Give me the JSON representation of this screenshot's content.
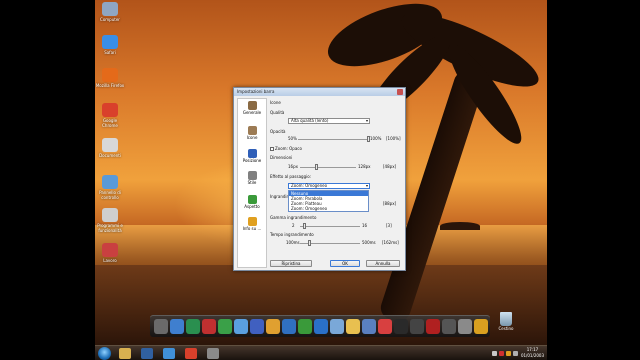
{
  "window": {
    "title": "Impostazioni barra"
  },
  "desktop_icons": [
    {
      "label": "Computer",
      "icon": "computer-icon",
      "color": "#8fa6c2"
    },
    {
      "label": "Safari",
      "icon": "safari-icon",
      "color": "#3a8ee6"
    },
    {
      "label": "Mozilla Firefox",
      "icon": "firefox-icon",
      "color": "#e46a1a"
    },
    {
      "label": "Google Chrome",
      "icon": "chrome-icon",
      "color": "#d9402b"
    },
    {
      "label": "Documenti",
      "icon": "documents-icon",
      "color": "#d8d8d8"
    },
    {
      "label": "Pannello di controllo",
      "icon": "control-panel-icon",
      "color": "#5a9ad8"
    },
    {
      "label": "Programmi e funzionalità",
      "icon": "programs-icon",
      "color": "#cfcfcf"
    },
    {
      "label": "Lavoro",
      "icon": "work-icon",
      "color": "#c94040"
    }
  ],
  "sidebar": {
    "items": [
      {
        "label": "Generale",
        "icon": "tools-icon",
        "color": "#8a6a44"
      },
      {
        "label": "Icone",
        "icon": "icons-icon",
        "color": "#9c7b54"
      },
      {
        "label": "Posizione",
        "icon": "position-icon",
        "color": "#2f5fb8"
      },
      {
        "label": "Stile",
        "icon": "brush-icon",
        "color": "#808080"
      },
      {
        "label": "Aspetto",
        "icon": "appearance-icon",
        "color": "#3a9a3a"
      },
      {
        "label": "Info su ...",
        "icon": "info-icon",
        "color": "#e0a020"
      }
    ]
  },
  "settings": {
    "section": "Icone",
    "quality_label": "Qualità",
    "quality_value": "Alta qualità (lento)",
    "opacity_label": "Opacità",
    "opacity_min": "50%",
    "opacity_max": "100%",
    "opacity_value": "[100%]",
    "opacity_level": 1.0,
    "zoom_opaque_label": "Zoom: Opaco",
    "dimensions_label": "Dimensioni",
    "dim_min": "16px",
    "dim_max": "128px",
    "dim_value": "[48px]",
    "dim_level": 0.29,
    "hover_label": "Effetto al passaggio:",
    "hover_value": "Zoom: Omogeneo",
    "hover_options": [
      "Nessuno",
      "Zoom: Parabola",
      "Zoom: Piatteau",
      "Zoom: Omogeneo"
    ],
    "hover_highlighted": "Nessuno",
    "zoom_label": "Ingrandimento",
    "zoom_value": "[88px]",
    "gamma_label": "Gamma ingrandimento",
    "gamma_min": "2",
    "gamma_max": "16",
    "gamma_value": "[3]",
    "gamma_level": 0.07,
    "time_label": "Tempo ingrandimento",
    "time_min": "100ms",
    "time_max": "500ms",
    "time_value": "[162ms]",
    "time_level": 0.16
  },
  "buttons": {
    "reset": "Ripristina",
    "ok": "OK",
    "cancel": "Annulla"
  },
  "dock_icons": [
    {
      "icon": "dock-app-1-icon",
      "color": "#6a6a6a"
    },
    {
      "icon": "dock-app-2-icon",
      "color": "#3f7fcf"
    },
    {
      "icon": "dock-app-3-icon",
      "color": "#2a8f4f"
    },
    {
      "icon": "dock-app-4-icon",
      "color": "#c03030"
    },
    {
      "icon": "dock-chrome-icon",
      "color": "#3aa048"
    },
    {
      "icon": "dock-app-6-icon",
      "color": "#5aa0e0"
    },
    {
      "icon": "dock-app-7-icon",
      "color": "#4060c0"
    },
    {
      "icon": "dock-app-8-icon",
      "color": "#e0a030"
    },
    {
      "icon": "dock-app-9-icon",
      "color": "#3070c0"
    },
    {
      "icon": "dock-utorrent-icon",
      "color": "#3a9a3a"
    },
    {
      "icon": "dock-app-11-icon",
      "color": "#2a70c8"
    },
    {
      "icon": "dock-app-12-icon",
      "color": "#7aa8d8"
    },
    {
      "icon": "dock-folder-icon",
      "color": "#e8c050"
    },
    {
      "icon": "dock-app-14-icon",
      "color": "#5a80c0"
    },
    {
      "icon": "dock-media-icon",
      "color": "#d84040"
    },
    {
      "icon": "dock-app-16-icon",
      "color": "#2a2a2a"
    },
    {
      "icon": "dock-app-17-icon",
      "color": "#444444"
    },
    {
      "icon": "dock-app-18-icon",
      "color": "#b02020"
    },
    {
      "icon": "dock-app-19-icon",
      "color": "#555555"
    },
    {
      "icon": "dock-app-20-icon",
      "color": "#8a8a8a"
    },
    {
      "icon": "dock-app-21-icon",
      "color": "#d8a020"
    }
  ],
  "trash": {
    "label": "Cestino"
  },
  "taskbar": {
    "buttons": [
      {
        "icon": "explorer-icon",
        "color": "#d8b050"
      },
      {
        "icon": "media-player-icon",
        "color": "#3060a0"
      },
      {
        "icon": "safari-taskbar-icon",
        "color": "#4090d8"
      },
      {
        "icon": "chrome-taskbar-icon",
        "color": "#d8402b"
      },
      {
        "icon": "network-taskbar-icon",
        "color": "#8a8a8a"
      }
    ],
    "time": "17:17",
    "date": "01/01/2003"
  }
}
